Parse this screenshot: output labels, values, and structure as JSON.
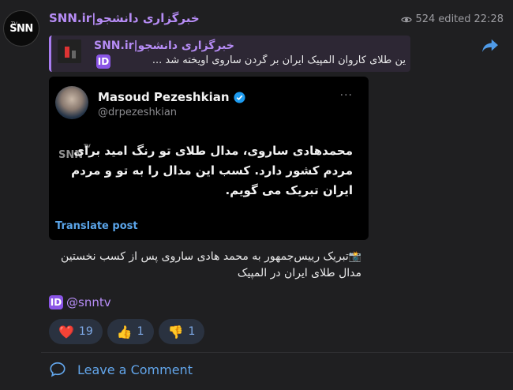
{
  "channel": {
    "name": "SNN.ir|خبرگزاری دانشجو",
    "avatar_logo": "SNN",
    "avatar_sub": "TV"
  },
  "meta": {
    "views": "524",
    "edited": "edited",
    "time": "22:28"
  },
  "reply": {
    "title": "SNN.ir|خبرگزاری دانشجو",
    "text": "ین طلای کاروان المپیک ایران بر گردن ساروی آویخته شد ...",
    "badge": "ID"
  },
  "tweet": {
    "name": "Masoud Pezeshkian",
    "handle": "@drpezeshkian",
    "more": "···",
    "body": "محمدهادی ساروی، مدال طلای تو رنگ امید برای مردم کشور دارد. کسب این مدال را به تو و مردم ایران تبریک می گویم.",
    "watermark": "SNN",
    "watermark_sub": "TV",
    "translate": "Translate post"
  },
  "caption": {
    "text": "تبریک رییس‌جمهور به محمد هادی ساروی پس از کسب نخستین مدال طلای ایران در المپیک",
    "icon": "📸"
  },
  "handle": {
    "badge": "ID",
    "text": "@snntv"
  },
  "reactions": [
    {
      "emoji": "❤️",
      "count": "19",
      "icon": "heart-icon"
    },
    {
      "emoji": "👍",
      "count": "1",
      "icon": "thumbs-up-icon"
    },
    {
      "emoji": "👎",
      "count": "1",
      "icon": "thumbs-down-icon"
    }
  ],
  "comment": {
    "label": "Leave a Comment"
  },
  "colors": {
    "accent": "#b68cf5",
    "link": "#62a5ea",
    "background": "#1f1f21"
  }
}
